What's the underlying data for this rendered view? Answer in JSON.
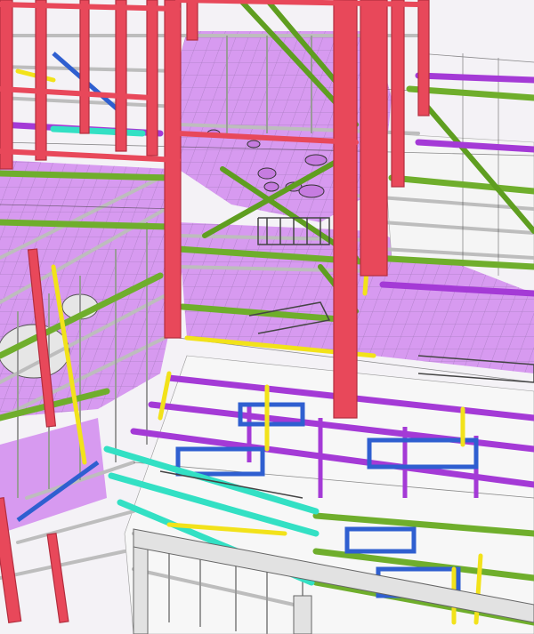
{
  "scene": {
    "subject": "steel-structure-3d-model",
    "palette": {
      "column": "#e8485a",
      "column_dark": "#b32d3e",
      "beam_green": "#6fae2c",
      "beam_purple": "#a43ad6",
      "beam_yellow": "#f2e21a",
      "beam_cyan": "#33e0c4",
      "beam_blue": "#2f5fd0",
      "beam_grey": "#c9c9c9",
      "grating": "#d79af0",
      "grating_grid": "#8b6aa2",
      "background": "#f4f2f6",
      "outline": "#1a1a1a"
    }
  }
}
